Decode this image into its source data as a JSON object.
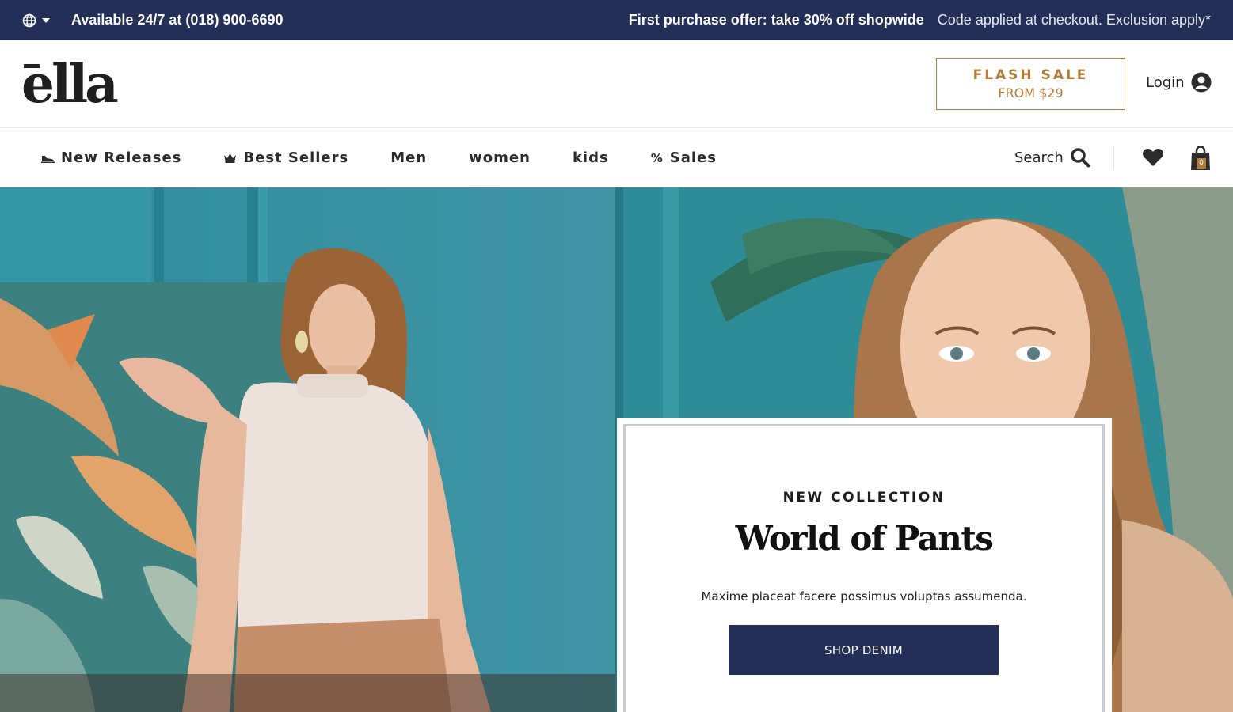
{
  "topbar": {
    "support": "Available 24/7 at (018) 900-6690",
    "offer_bold": "First purchase offer: take 30% off shopwide",
    "offer_note": "Code applied at checkout. Exclusion apply*",
    "language_icon": "globe-icon",
    "background": "#232f57"
  },
  "header": {
    "logo": "ella",
    "flash_title": "FLASH SALE",
    "flash_sub": "FROM $29",
    "login": "Login",
    "accent": "#b07c3a"
  },
  "nav": {
    "items": [
      {
        "label": "New Releases",
        "icon": "shoe-icon"
      },
      {
        "label": "Best Sellers",
        "icon": "crown-icon"
      },
      {
        "label": "Men"
      },
      {
        "label": "women"
      },
      {
        "label": "kids"
      },
      {
        "label": "Sales",
        "icon": "percent-icon"
      }
    ],
    "search": "Search",
    "cart_count": "0"
  },
  "hero": {
    "kicker": "NEW COLLECTION",
    "title": "World of Pants",
    "description": "Maxime placeat facere possimus voluptas assumenda.",
    "button": "SHOP DENIM",
    "button_color": "#232f57"
  }
}
